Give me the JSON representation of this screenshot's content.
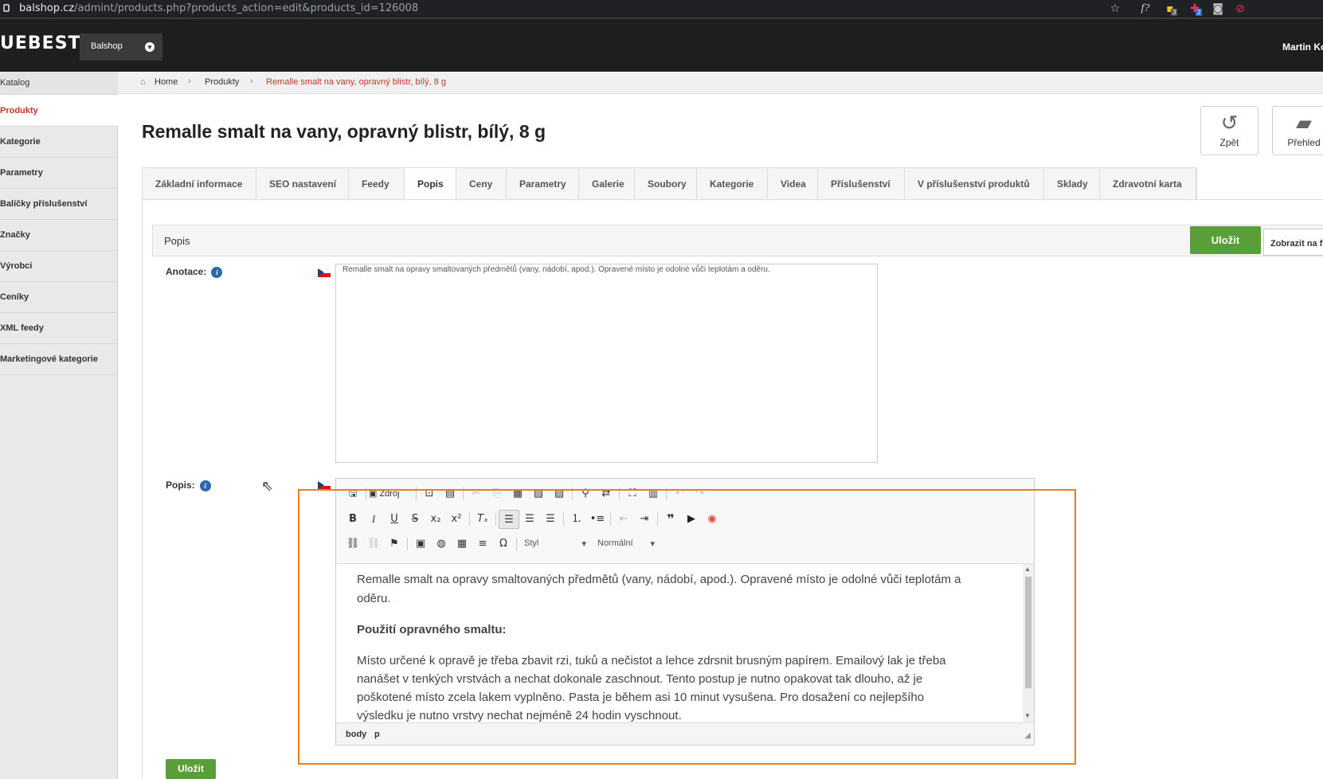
{
  "browser": {
    "url_domain": "balshop.cz",
    "url_path": "/admint/products.php?products_action=edit&products_id=126008",
    "ext_badges": [
      "3",
      "2"
    ]
  },
  "header": {
    "logo": "UEBEST",
    "shop": "Balshop",
    "user": "Martin Ko"
  },
  "sidebar": {
    "items": [
      "Katalog",
      "Produkty",
      "Kategorie",
      "Parametry",
      "Balíčky příslušenství",
      "Značky",
      "Výrobci",
      "Ceníky",
      "XML feedy",
      "Marketingové kategorie"
    ]
  },
  "breadcrumb": {
    "home": "Home",
    "level1": "Produkty",
    "current": "Remalle smalt na vany, opravný blistr, bílý, 8 g"
  },
  "page": {
    "title": "Remalle smalt na vany, opravný blistr, bílý, 8 g"
  },
  "actions": {
    "back": "Zpět",
    "overview": "Přehled"
  },
  "tabs": [
    "Základní informace",
    "SEO nastavení",
    "Feedy",
    "Popis",
    "Ceny",
    "Parametry",
    "Galerie",
    "Soubory",
    "Kategorie",
    "Videa",
    "Příslušenství",
    "V příslušenství produktů",
    "Sklady",
    "Zdravotní karta"
  ],
  "panel": {
    "title": "Popis",
    "save": "Uložit",
    "show_button": "Zobrazit na f"
  },
  "form": {
    "annotation_label": "Anotace:",
    "annotation_text": "Remalle smalt na opravy smaltovaných předmětů (vany, nádobí, apod.). Opravené místo je odolné vůči teplotám a oděru.",
    "description_label": "Popis:",
    "bottom_save": "Uložit"
  },
  "editor": {
    "source_label": "Zdroj",
    "style_combo": "Styl",
    "format_combo": "Normální",
    "paragraphs": [
      "Remalle smalt na opravy smaltovaných předmětů (vany, nádobí, apod.). Opravené místo je odolné vůči teplotám a oděru.",
      "Použití opravného smaltu:",
      "Místo určené k opravě je třeba zbavit rzi, tuků a nečistot a lehce zdrsnit brusným papírem. Emailový lak je třeba nanášet v tenkých vrstvách a nechat dokonale zaschnout. Tento postup je nutno opakovat tak dlouho, až je poškotené místo zcela lakem vyplněno. Pasta je během asi 10 minut vysušena. Pro dosažení co nejlepšího výsledku je nutno vrstvy nechat nejméně 24 hodin vyschnout."
    ],
    "path": [
      "body",
      "p"
    ]
  },
  "colors": {
    "accent_red": "#c0392b",
    "save_green": "#5a9e3a",
    "highlight_orange": "#f07d1a"
  }
}
